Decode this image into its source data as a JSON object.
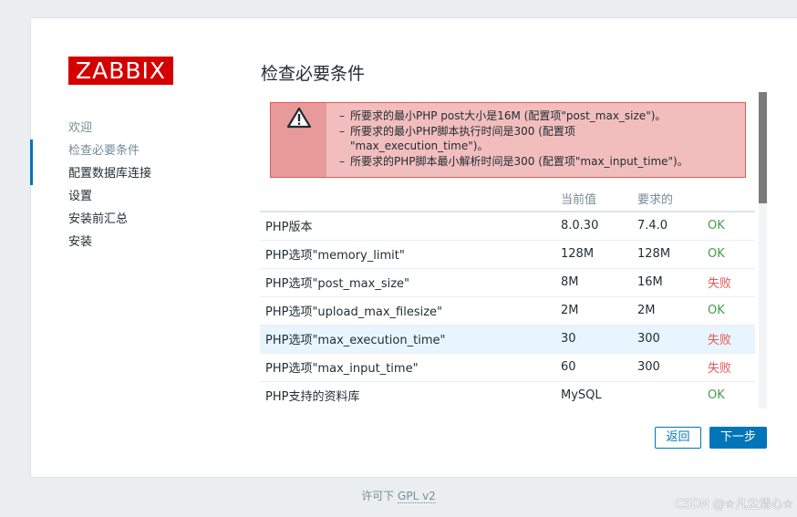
{
  "logo": {
    "text": "ZABBIX",
    "color": "#d40000"
  },
  "nav": {
    "items": [
      {
        "label": "欢迎",
        "state": "done"
      },
      {
        "label": "检查必要条件",
        "state": "active"
      },
      {
        "label": "配置数据库连接",
        "state": "pending"
      },
      {
        "label": "设置",
        "state": "pending"
      },
      {
        "label": "安装前汇总",
        "state": "pending"
      },
      {
        "label": "安装",
        "state": "pending"
      }
    ]
  },
  "page": {
    "title": "检查必要条件"
  },
  "alert": {
    "icon": "warning-icon",
    "messages": [
      {
        "dash": "–",
        "text": "所要求的最小PHP post大小是16M (配置项\"post_max_size\")。"
      },
      {
        "dash": "–",
        "text": "所要求的最小PHP脚本执行时间是300 (配置项"
      },
      {
        "dash": "",
        "text": "\"max_execution_time\")。"
      },
      {
        "dash": "–",
        "text": "所要求的PHP脚本最小解析时间是300 (配置项\"max_input_time\")。"
      }
    ]
  },
  "table": {
    "headers": [
      "",
      "当前值",
      "要求的",
      ""
    ],
    "rows": [
      {
        "name": "PHP版本",
        "current": "8.0.30",
        "required": "7.4.0",
        "status": "OK",
        "ok": true
      },
      {
        "name": "PHP选项\"memory_limit\"",
        "current": "128M",
        "required": "128M",
        "status": "OK",
        "ok": true
      },
      {
        "name": "PHP选项\"post_max_size\"",
        "current": "8M",
        "required": "16M",
        "status": "失败",
        "ok": false
      },
      {
        "name": "PHP选项\"upload_max_filesize\"",
        "current": "2M",
        "required": "2M",
        "status": "OK",
        "ok": true
      },
      {
        "name": "PHP选项\"max_execution_time\"",
        "current": "30",
        "required": "300",
        "status": "失败",
        "ok": false,
        "highlighted": true
      },
      {
        "name": "PHP选项\"max_input_time\"",
        "current": "60",
        "required": "300",
        "status": "失败",
        "ok": false
      },
      {
        "name": "PHP支持的资料库",
        "current": "MySQL",
        "required": "",
        "status": "OK",
        "ok": true
      }
    ]
  },
  "buttons": {
    "back": "返回",
    "next": "下一步"
  },
  "footer": {
    "prefix": "许可下",
    "link": "GPL v2"
  },
  "watermark": "CSDN @☆凡尘清心☆",
  "colors": {
    "accent": "#0275b8",
    "ok": "#429e47",
    "fail": "#e45959",
    "alert_border": "#e45959"
  }
}
